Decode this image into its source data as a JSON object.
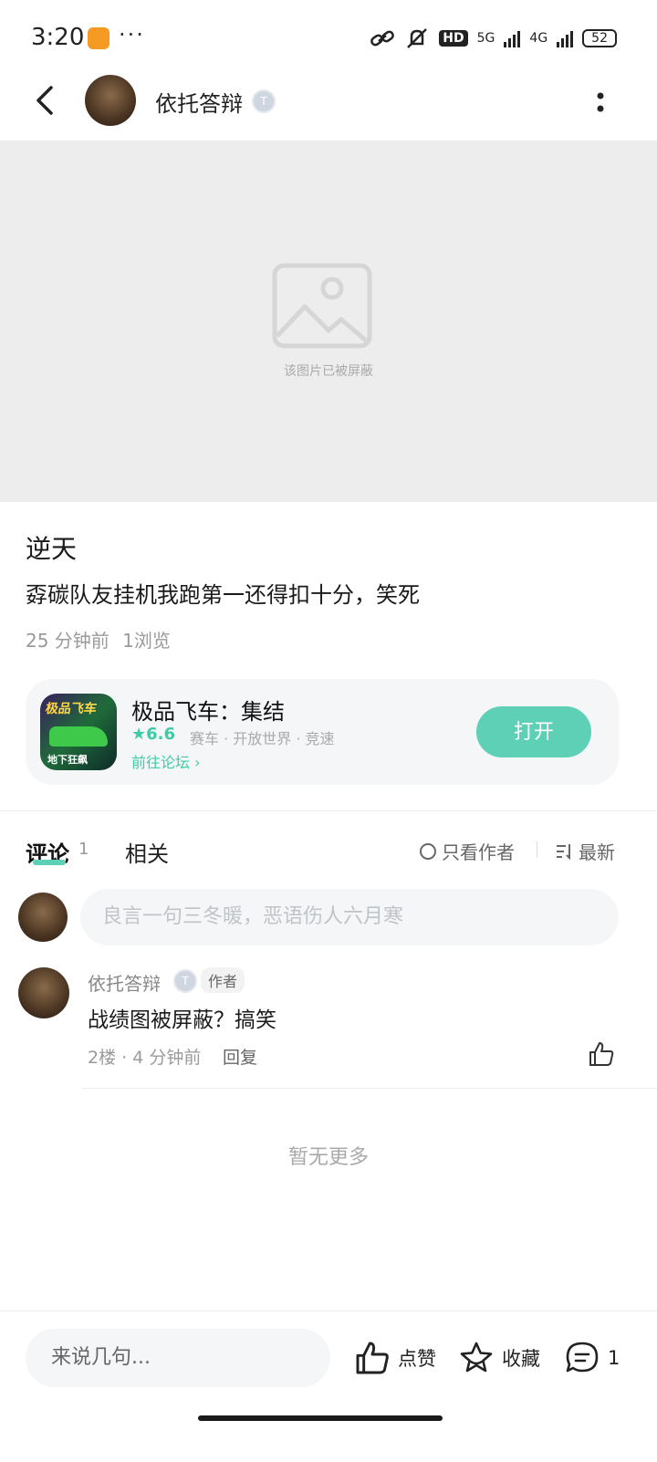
{
  "status_bar": {
    "time": "3:20",
    "dots": "···",
    "hd": "HD",
    "net1": "5G",
    "net2": "4G",
    "battery": "52"
  },
  "header": {
    "user_name": "依托答辩",
    "badge": "T"
  },
  "image": {
    "blocked_text": "该图片已被屏蔽"
  },
  "post": {
    "title": "逆天",
    "body": "孬碳队友挂机我跑第一还得扣十分，笑死",
    "time": "25 分钟前",
    "views": "1浏览"
  },
  "game_card": {
    "name": "极品飞车：集结",
    "rating": "★6.6",
    "tags": "赛车 · 开放世界 · 竞速",
    "forum_link": "前往论坛 ›",
    "open_button": "打开",
    "icon_title": "极品飞车",
    "icon_sub": "地下狂飙"
  },
  "tabs": {
    "comment": "评论",
    "comment_count": "1",
    "related": "相关",
    "author_only": "只看作者",
    "sort": "最新"
  },
  "comment_input": {
    "placeholder": "良言一句三冬暖，恶语伤人六月寒"
  },
  "comments": [
    {
      "user": "依托答辩",
      "badge": "T",
      "author_tag": "作者",
      "text": "战绩图被屏蔽？搞笑",
      "meta": "2楼 · 4 分钟前",
      "reply": "回复"
    }
  ],
  "no_more": "暂无更多",
  "bottom_bar": {
    "input_placeholder": "来说几句...",
    "like": "点赞",
    "favorite": "收藏",
    "comment_count": "1"
  },
  "colors": {
    "accent": "#5dd0b5",
    "text_green": "#3ecba6",
    "muted": "#9a9a9a",
    "card_bg": "#f4f6f8"
  }
}
